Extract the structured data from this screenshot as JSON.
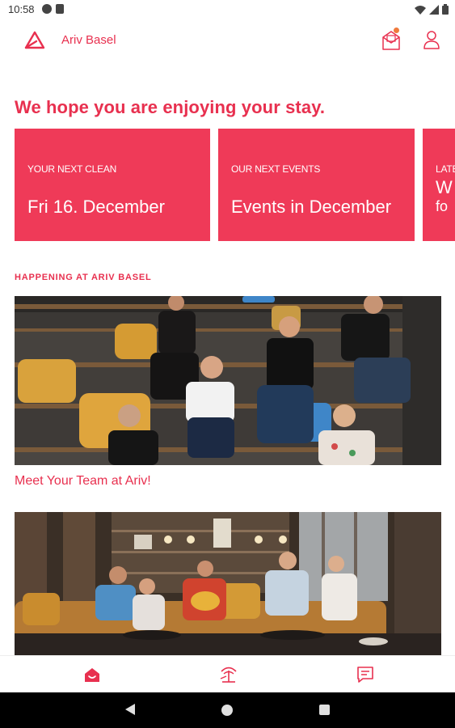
{
  "status_bar": {
    "time": "10:58",
    "left_icons": [
      "notification-icon",
      "sim-icon"
    ],
    "right_icons": [
      "wifi-icon",
      "signal-icon",
      "battery-icon"
    ]
  },
  "header": {
    "title": "Ariv Basel",
    "logo_icon": "ariv-logo-icon",
    "mail_icon": "mail-icon",
    "profile_icon": "profile-icon",
    "mail_badge": true
  },
  "greeting": "We hope you are enjoying your stay.",
  "cards": [
    {
      "kicker": "YOUR NEXT CLEAN",
      "title": "Fri 16. December"
    },
    {
      "kicker": "OUR NEXT EVENTS",
      "title": "Events in December"
    },
    {
      "kicker": "LATE",
      "title": "W",
      "title_line2": "fo"
    }
  ],
  "section": {
    "label": "HAPPENING AT ARIV BASEL",
    "items": [
      {
        "caption": "Meet Your Team at Ariv!",
        "image": "team-photo"
      },
      {
        "caption": "",
        "image": "lounge-photo"
      }
    ]
  },
  "bottom_nav": [
    {
      "name": "home",
      "icon": "home-icon",
      "active": true
    },
    {
      "name": "plans",
      "icon": "palm-tree-icon",
      "active": false
    },
    {
      "name": "chat",
      "icon": "chat-icon",
      "active": false
    }
  ],
  "colors": {
    "accent": "#e8304f",
    "card": "#ef3a58",
    "badge": "#f07a3c"
  }
}
